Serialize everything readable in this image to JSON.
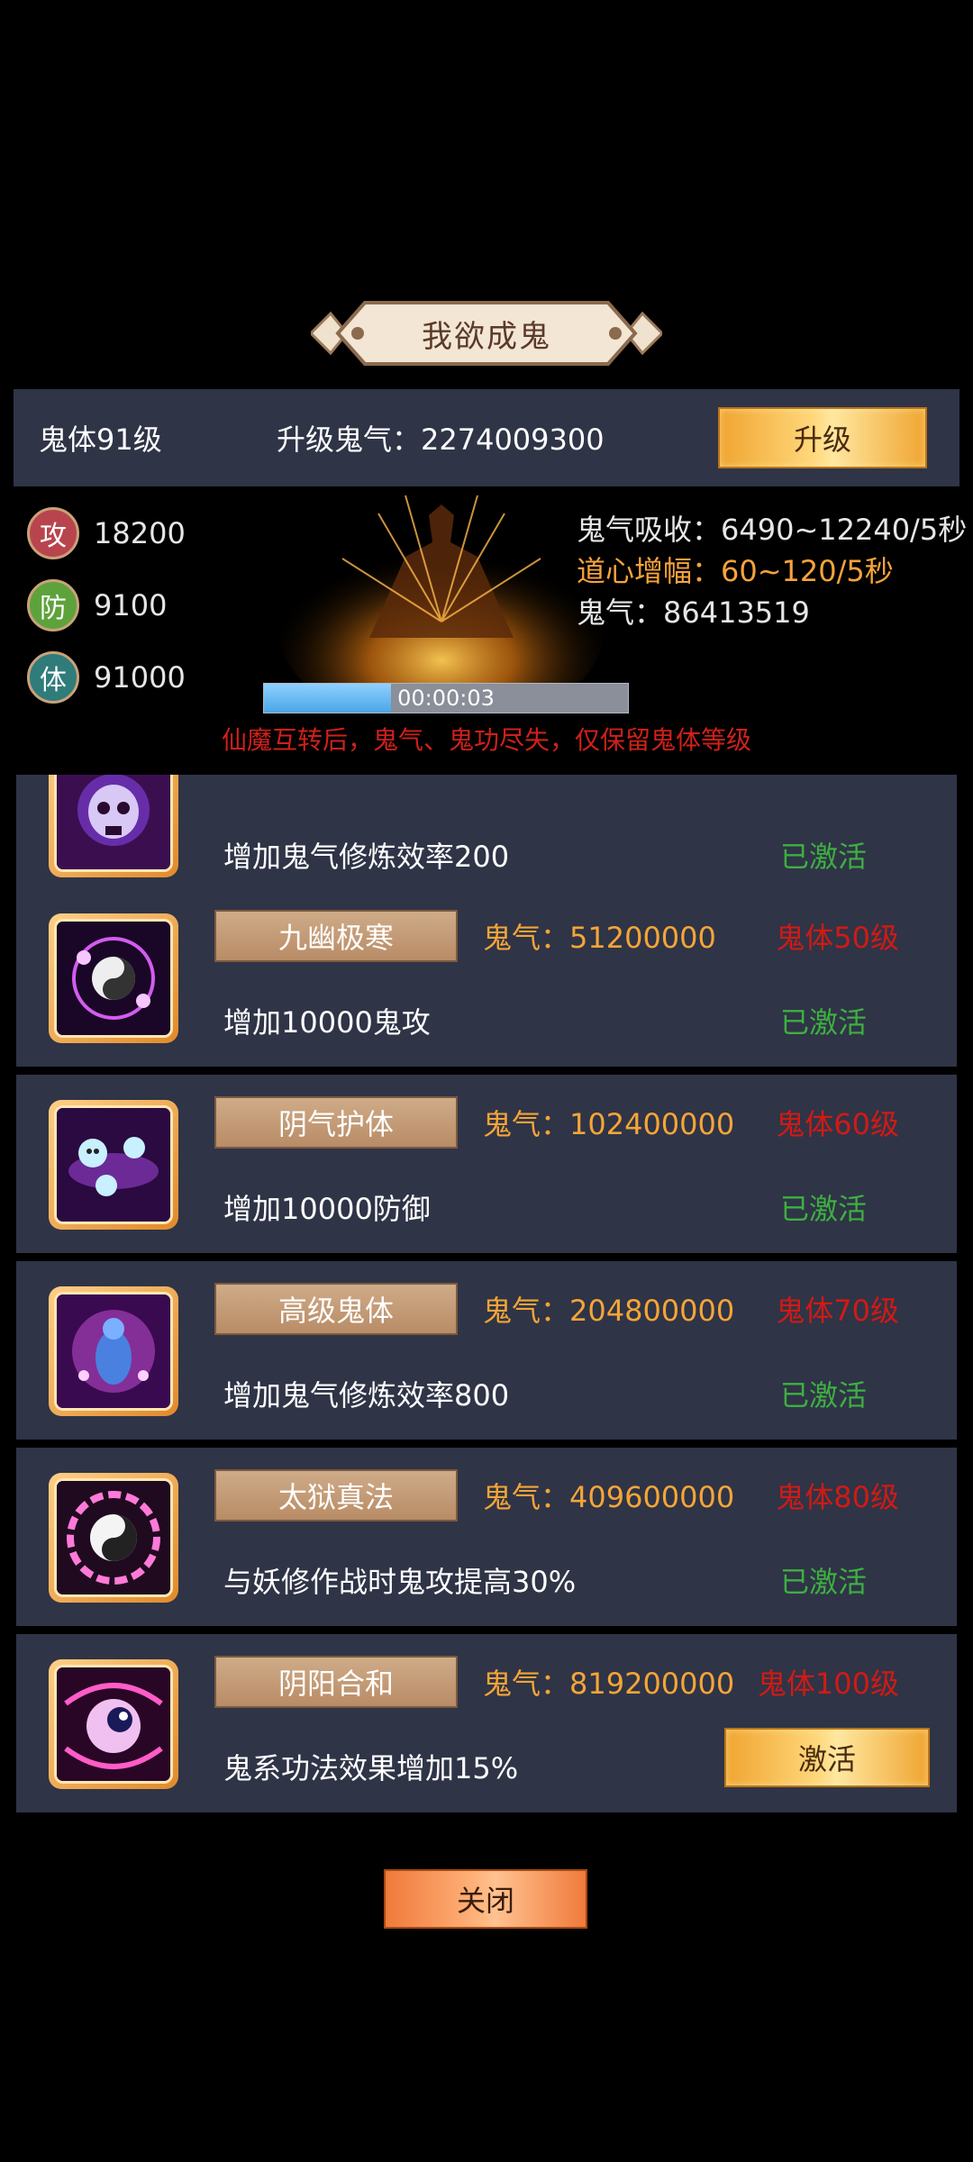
{
  "title": "我欲成鬼",
  "info_bar": {
    "ghost_level": "鬼体91级",
    "upgrade_cost": "升级鬼气：2274009300",
    "upgrade_label": "升级"
  },
  "stats": [
    {
      "badge": "攻",
      "value": "18200",
      "color": "#b8454e"
    },
    {
      "badge": "防",
      "value": "9100",
      "color": "#5ea23c"
    },
    {
      "badge": "体",
      "value": "91000",
      "color": "#2f7c7a"
    }
  ],
  "right_stats": {
    "absorb": "鬼气吸收：6490~12240/5秒",
    "dao_boost": "道心增幅：60~120/5秒",
    "ghost_qi": "鬼气：86413519"
  },
  "progress": {
    "time": "00:00:03",
    "fraction": 0.35
  },
  "warning": "仙魔互转后，鬼气、鬼功尽失，仅保留鬼体等级",
  "skills": [
    {
      "name": "",
      "cost": "",
      "req": "",
      "desc": "增加鬼气修炼效率200",
      "status": "已激活",
      "partial": true
    },
    {
      "name": "九幽极寒",
      "cost": "鬼气：51200000",
      "req": "鬼体50级",
      "desc": "增加10000鬼攻",
      "status": "已激活"
    },
    {
      "name": "阴气护体",
      "cost": "鬼气：102400000",
      "req": "鬼体60级",
      "desc": "增加10000防御",
      "status": "已激活"
    },
    {
      "name": "高级鬼体",
      "cost": "鬼气：204800000",
      "req": "鬼体70级",
      "desc": "增加鬼气修炼效率800",
      "status": "已激活"
    },
    {
      "name": "太狱真法",
      "cost": "鬼气：409600000",
      "req": "鬼体80级",
      "desc": "与妖修作战时鬼攻提高30%",
      "status": "已激活"
    },
    {
      "name": "阴阳合和",
      "cost": "鬼气：819200000",
      "req": "鬼体100级",
      "desc": "鬼系功法效果增加15%",
      "status": "",
      "button": "激活"
    }
  ],
  "close_label": "关闭",
  "icons": [
    "skull-skill-icon",
    "yin-yang-orb-icon",
    "skull-orbs-icon",
    "ghost-spirit-icon",
    "bagua-icon",
    "yin-yang-eye-icon"
  ]
}
